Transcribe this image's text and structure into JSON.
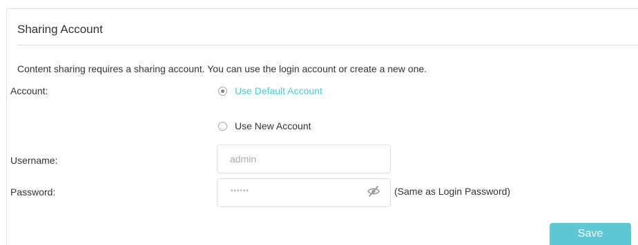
{
  "panel": {
    "title": "Sharing Account",
    "description": "Content sharing requires a sharing account. You can use the login account or create a new one."
  },
  "account": {
    "label": "Account:",
    "options": [
      {
        "label": "Use Default Account",
        "selected": true
      },
      {
        "label": "Use New Account",
        "selected": false
      }
    ]
  },
  "username": {
    "label": "Username:",
    "placeholder": "admin"
  },
  "password": {
    "label": "Password:",
    "masked_value": "••••••",
    "hint": "(Same as Login Password)",
    "toggle_icon": "eye-slash-icon"
  },
  "actions": {
    "save_label": "Save"
  },
  "colors": {
    "accent": "#4acbd6",
    "button": "#5fc7d4",
    "text": "#333333",
    "border": "#e1e1e1"
  }
}
